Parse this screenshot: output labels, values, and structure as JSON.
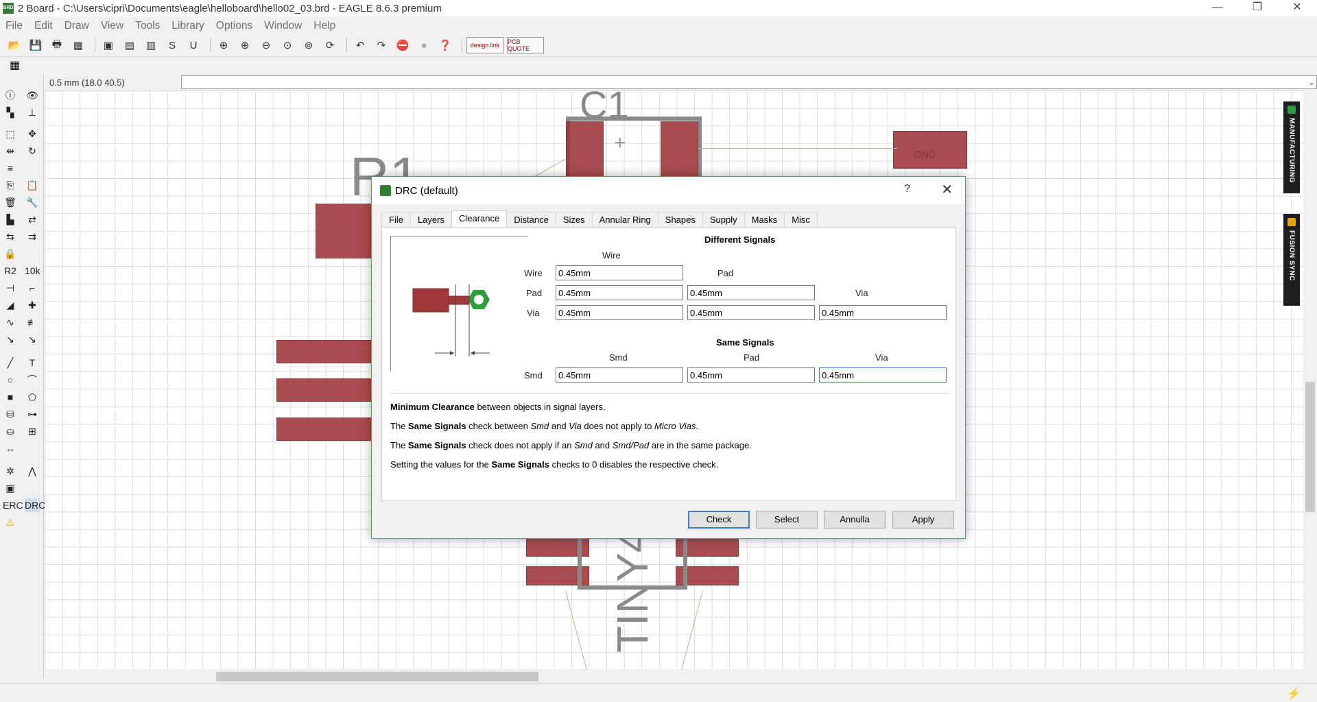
{
  "window": {
    "title": "2 Board - C:\\Users\\cipri\\Documents\\eagle\\helloboard\\hello02_03.brd - EAGLE 8.6.3 premium",
    "app_icon": "eagle-board-icon",
    "controls": [
      "minimize-icon",
      "restore-icon",
      "close-icon"
    ]
  },
  "menu": [
    "File",
    "Edit",
    "Draw",
    "View",
    "Tools",
    "Library",
    "Options",
    "Window",
    "Help"
  ],
  "toolbar": {
    "design_link_label": "design link",
    "pcb_quote_label": "PCB QUOTE"
  },
  "coordbar": {
    "coordinates": "0.5 mm (18.0 40.5)"
  },
  "canvas": {
    "labels": {
      "c1": "C1",
      "r1": "R1",
      "gnd": "GND",
      "attiny": "TINY4"
    }
  },
  "side_tabs": {
    "manufacturing": "MANUFACTURING",
    "fusion_sync": "FUSION SYNC"
  },
  "dialog": {
    "title": "DRC (default)",
    "help_label": "?",
    "close_label": "✕",
    "tabs": [
      "File",
      "Layers",
      "Clearance",
      "Distance",
      "Sizes",
      "Annular Ring",
      "Shapes",
      "Supply",
      "Masks",
      "Misc"
    ],
    "active_tab": "Clearance",
    "different_signals": {
      "title": "Different Signals",
      "col_wire": "Wire",
      "col_pad": "Pad",
      "col_via": "Via",
      "row_wire": "Wire",
      "row_pad": "Pad",
      "row_via": "Via",
      "wire_wire": "0.45mm",
      "pad_wire": "0.45mm",
      "pad_pad": "0.45mm",
      "via_wire": "0.45mm",
      "via_pad": "0.45mm",
      "via_via": "0.45mm"
    },
    "same_signals": {
      "title": "Same Signals",
      "col_smd": "Smd",
      "col_pad": "Pad",
      "col_via": "Via",
      "row_smd": "Smd",
      "smd_smd": "0.45mm",
      "smd_pad": "0.45mm",
      "smd_via": "0.45mm"
    },
    "help": {
      "line1_bold": "Minimum Clearance",
      "line1_rest": " between objects in signal layers.",
      "line2_a": "The ",
      "line2_bold": "Same Signals",
      "line2_b": " check between ",
      "line2_i1": "Smd",
      "line2_c": " and ",
      "line2_i2": "Via",
      "line2_d": " does not apply to ",
      "line2_i3": "Micro Vias",
      "line2_e": ".",
      "line3_a": "The ",
      "line3_bold": "Same Signals",
      "line3_b": " check does not apply if an ",
      "line3_i1": "Smd",
      "line3_c": " and ",
      "line3_i2": "Smd/Pad",
      "line3_d": " are in the same package.",
      "line4_a": "Setting the values for the ",
      "line4_bold": "Same Signals",
      "line4_b": " checks to 0 disables the respective check."
    },
    "buttons": {
      "check": "Check",
      "select": "Select",
      "cancel": "Annulla",
      "apply": "Apply"
    }
  },
  "colors": {
    "pad": "#a0393c",
    "silkscreen": "#8a8a8a",
    "airwire": "#b8b88a",
    "accent": "#3a7bd5",
    "via_ring": "#2e9e3e"
  }
}
